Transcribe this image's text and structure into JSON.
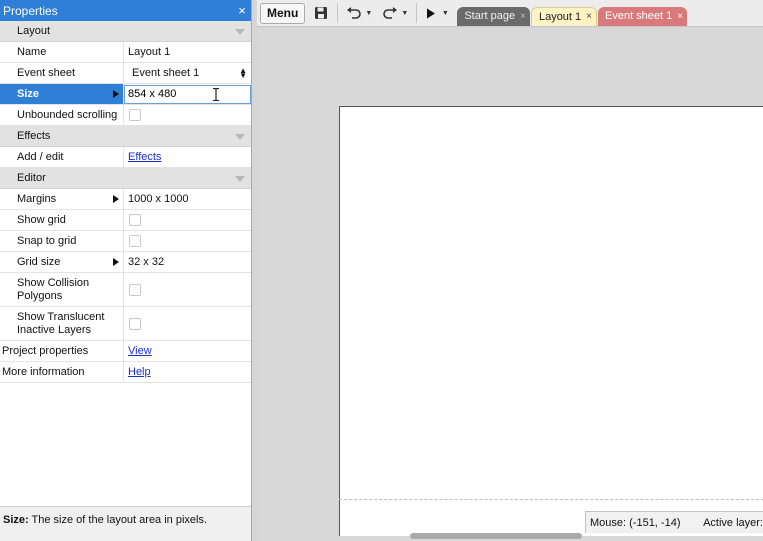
{
  "panel": {
    "title": "Properties",
    "close_glyph": "×",
    "sections": {
      "layout": "Layout",
      "effects": "Effects",
      "editor": "Editor"
    },
    "rows": {
      "name": {
        "label": "Name",
        "value": "Layout 1"
      },
      "event_sheet": {
        "label": "Event sheet",
        "value": "Event sheet 1"
      },
      "size": {
        "label": "Size",
        "value": "854 x 480"
      },
      "unbounded_scrolling": {
        "label": "Unbounded scrolling",
        "checked": false
      },
      "add_edit": {
        "label": "Add / edit",
        "link": "Effects"
      },
      "margins": {
        "label": "Margins",
        "value": "1000 x 1000"
      },
      "show_grid": {
        "label": "Show grid",
        "checked": false
      },
      "snap_to_grid": {
        "label": "Snap to grid",
        "checked": false
      },
      "grid_size": {
        "label": "Grid size",
        "value": "32 x 32"
      },
      "show_collision_1": "Show Collision",
      "show_collision_2": "Polygons",
      "show_translucent_1": "Show Translucent",
      "show_translucent_2": "Inactive Layers",
      "project_properties": {
        "label": "Project properties",
        "link": "View"
      },
      "more_information": {
        "label": "More information",
        "link": "Help"
      }
    },
    "description": {
      "key": "Size:",
      "text": " The size of the layout area in pixels."
    }
  },
  "toolbar": {
    "menu_label": "Menu",
    "icons": [
      "save-icon",
      "undo-icon",
      "redo-icon",
      "play-icon"
    ]
  },
  "tabs": [
    {
      "label": "Start page",
      "close": "×"
    },
    {
      "label": "Layout 1",
      "close": "×"
    },
    {
      "label": "Event sheet 1",
      "close": "×"
    }
  ],
  "status": {
    "mouse": "Mouse: (-151, -14)",
    "active_layer": "Active layer:"
  },
  "colors": {
    "accent": "#2f7fd6",
    "tab_layout": "#fdf2c3",
    "tab_event": "#d9797c",
    "tab_start": "#6a6a6a"
  }
}
